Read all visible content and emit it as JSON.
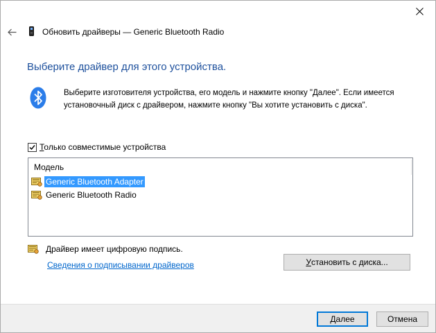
{
  "window": {
    "close_icon": "close-icon"
  },
  "header": {
    "back_icon": "back-arrow-icon",
    "device_icon": "bluetooth-device-icon",
    "title": "Обновить драйверы — Generic Bluetooth Radio"
  },
  "main": {
    "heading": "Выберите драйвер для этого устройства.",
    "bluetooth_icon": "bluetooth-icon",
    "instructions": [
      "Выберите изготовителя устройства, его модель и нажмите кнопку \"Далее\". Если имеется",
      "установочный диск с  драйвером, нажмите кнопку \"Вы хотите установить с диска\"."
    ]
  },
  "compatible": {
    "checked": true,
    "label_first": "Т",
    "label_rest": "олько совместимые устройства"
  },
  "list": {
    "header": "Модель",
    "items": [
      {
        "label": "Generic Bluetooth Adapter",
        "selected": true,
        "icon": "driver-icon"
      },
      {
        "label": "Generic Bluetooth Radio",
        "selected": false,
        "icon": "driver-icon"
      }
    ]
  },
  "signature": {
    "icon": "signed-driver-icon",
    "text": "Драйвер имеет цифровую подпись.",
    "link": "Сведения о подписывании драйверов"
  },
  "buttons": {
    "install_pre": "",
    "install_first": "У",
    "install_rest": "становить с диска...",
    "next_first": "Д",
    "next_rest": "алее",
    "cancel": "Отмена"
  },
  "colors": {
    "heading": "#1c4f9c",
    "link": "#0066cc",
    "selection": "#3399ff",
    "bluetooth": "#2b7de9",
    "default_button_border": "#0078d7"
  }
}
